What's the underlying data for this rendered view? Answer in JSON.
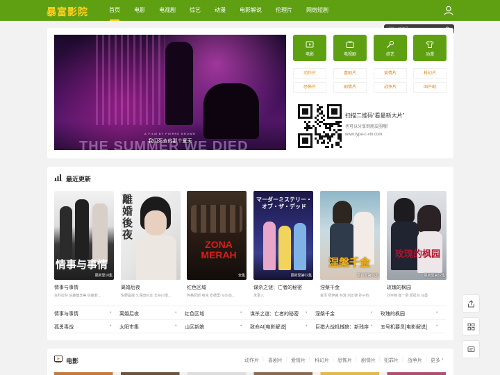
{
  "header": {
    "logo": "暴富影院",
    "nav": [
      "首页",
      "电影",
      "电视剧",
      "综艺",
      "动漫",
      "电影解说",
      "伦理片",
      "网络短剧"
    ]
  },
  "search": {
    "placeholder": "请输入关键词..."
  },
  "banner": {
    "caption": "我们死去的那个夏天",
    "poster_text": "THE SUMMER WE DIED",
    "poster_small": "A FILM BY PIERRE BROWN"
  },
  "categories": [
    "电影",
    "电视剧",
    "综艺",
    "动漫"
  ],
  "genres": [
    [
      "动作片",
      "喜剧片",
      "爱情片",
      "科幻片"
    ],
    [
      "恐怖片",
      "剧情片",
      "战争片",
      "国产剧"
    ]
  ],
  "qr": {
    "title": "扫描二维码“看最新大片”",
    "subtitle": "也可以分享到朋友圈哦！",
    "url": "www.type-c-vin.com"
  },
  "recent": {
    "title": "最近更新",
    "cards": [
      {
        "title": "情事与事情",
        "cast": "台科拉芬 佐藤健李美 佐藤若…",
        "badge": "更新至10集",
        "poster_text": "情事与事情"
      },
      {
        "title": "离婚后夜",
        "cast": "佐野晶哉 久保田纱友 长谷川博…",
        "badge": "",
        "poster_text": "離婚後夜"
      },
      {
        "title": "红色区域",
        "cast": "阿格尼斯·哈克 安德里·马沙迪…",
        "badge": "全集",
        "poster_text": "ZONA MERAH"
      },
      {
        "title": "谋杀之谜：亡者的秘密",
        "cast": "未录入",
        "badge": "更新至第02集",
        "poster_text": "マーダーミステリー・オブ・ザ・デッド"
      },
      {
        "title": "涅槃千金",
        "cast": "金泽 杨伊茜 林涛 刘正德 孙子钧",
        "badge": "更新至第06集",
        "poster_text": "涅槃千金"
      },
      {
        "title": "玫瑰的枫园",
        "cast": "刘宇峰 崔一梁 郭星台 马曼",
        "badge": "更新至第12集",
        "poster_text": "玫瑰的枫园"
      }
    ],
    "links": [
      [
        "情事与事情",
        "离婚后夜",
        "红色区域",
        "谋杀之谜：亡者的秘密",
        "涅槃千金",
        "玫瑰的枫园"
      ],
      [
        "孤勇毒战",
        "太阳市集",
        "山区新娘",
        "致命AI[电影解说]",
        "巨猎大战机械狼：新残序",
        "五号机要员[电影解说]"
      ]
    ]
  },
  "movies": {
    "title": "电影",
    "tabs": [
      "动作片",
      "喜剧片",
      "爱情片",
      "科幻片",
      "恐怖片",
      "剧情片",
      "犯罪片",
      "战争片",
      "更多"
    ]
  },
  "colors": {
    "brand": "#5fa012",
    "accent": "#ffd21f",
    "genre_text": "#e08a1a"
  },
  "side_tools": [
    "share-icon",
    "grid-icon",
    "feedback-icon"
  ]
}
